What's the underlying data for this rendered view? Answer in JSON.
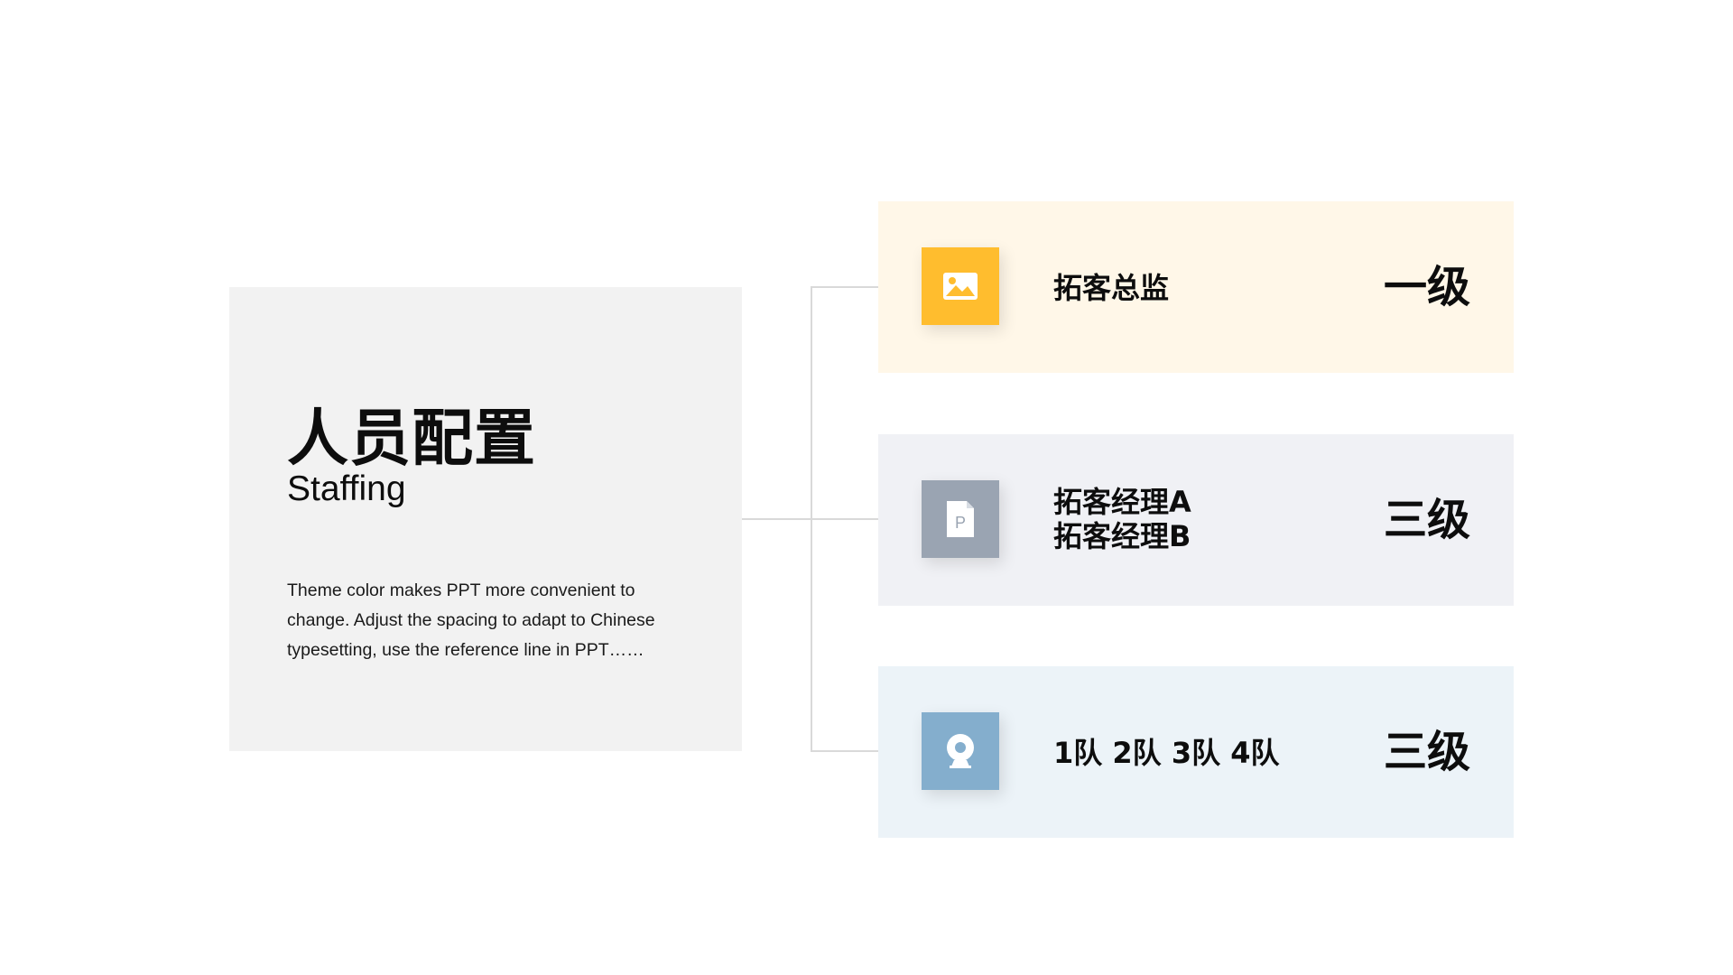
{
  "left_panel": {
    "title": "人员配置",
    "subtitle": "Staffing",
    "description": "Theme color makes PPT more convenient to change. Adjust the spacing to adapt to Chinese typesetting, use the reference line in PPT……"
  },
  "cards": [
    {
      "icon": "image-icon",
      "icon_color": "#ffbd2e",
      "lines": [
        "拓客总监"
      ],
      "level": "一级",
      "background": "#fff7e8"
    },
    {
      "icon": "document-icon",
      "icon_color": "#9aa4b2",
      "lines": [
        "拓客经理A",
        "拓客经理B"
      ],
      "level": "三级",
      "background": "#f0f1f5"
    },
    {
      "icon": "webcam-icon",
      "icon_color": "#84aecd",
      "lines": [
        "1队 2队 3队 4队"
      ],
      "level": "三级",
      "background": "#ecf3f8"
    }
  ]
}
